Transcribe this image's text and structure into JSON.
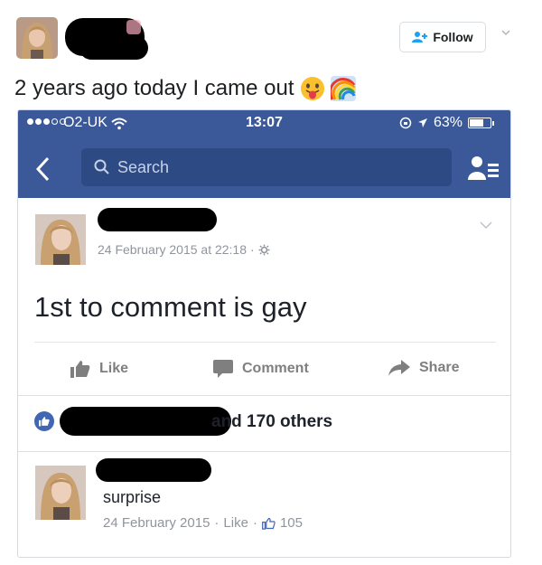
{
  "tweet": {
    "follow_label": "Follow",
    "text": "2 years ago today I came out",
    "emoji_1": "tongue-face-emoji",
    "emoji_2": "rainbow-emoji"
  },
  "phone": {
    "carrier": "O2-UK",
    "time": "13:07",
    "battery": "63%",
    "battery_level": 0.63
  },
  "facebook": {
    "search_placeholder": "Search",
    "post": {
      "timestamp": "24 February 2015 at 22:18",
      "text": "1st to comment is gay"
    },
    "actions": {
      "like": "Like",
      "comment": "Comment",
      "share": "Share"
    },
    "likes_summary": "and 170 others",
    "comment": {
      "text": "surprise",
      "date": "24 February 2015",
      "like_label": "Like",
      "like_count": "105"
    }
  },
  "colors": {
    "fb_blue": "#3b5998",
    "search_bg": "#2d4a85",
    "like_blue": "#4267b2",
    "muted": "#90949c"
  }
}
